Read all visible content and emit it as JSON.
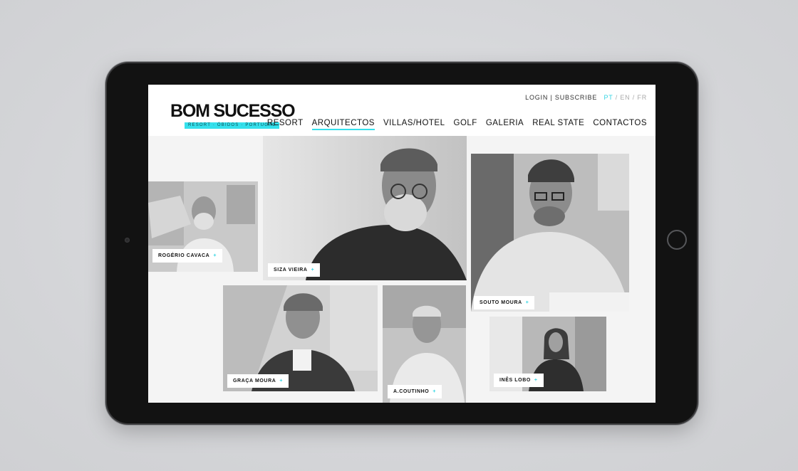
{
  "logo": {
    "title": "BOM SUCESSO",
    "tagline": "RESORT · ÓBIDOS · PORTUGAL"
  },
  "topbar": {
    "login": "LOGIN",
    "separator": "|",
    "subscribe": "SUBSCRIBE",
    "langs": [
      {
        "code": "PT",
        "active": true
      },
      {
        "code": "EN",
        "active": false
      },
      {
        "code": "FR",
        "active": false
      }
    ],
    "lang_separator": "/"
  },
  "nav": {
    "items": [
      {
        "label": "RESORT"
      },
      {
        "label": "ARQUITECTOS",
        "active": true
      },
      {
        "label": "VILLAS/HOTEL"
      },
      {
        "label": "GOLF"
      },
      {
        "label": "GALERIA"
      },
      {
        "label": "REAL STATE"
      },
      {
        "label": "CONTACTOS"
      }
    ]
  },
  "architects": [
    {
      "name": "ROGÉRIO CAVACA",
      "plus": "+"
    },
    {
      "name": "SIZA VIEIRA",
      "plus": "+"
    },
    {
      "name": "SOUTO MOURA",
      "plus": "+"
    },
    {
      "name": "GRAÇA MOURA",
      "plus": "+"
    },
    {
      "name": "A.COUTINHO",
      "plus": "+"
    },
    {
      "name": "INÊS LOBO",
      "plus": "+"
    }
  ],
  "colors": {
    "accent": "#35e0ec",
    "text": "#111111",
    "background": "#ffffff"
  }
}
